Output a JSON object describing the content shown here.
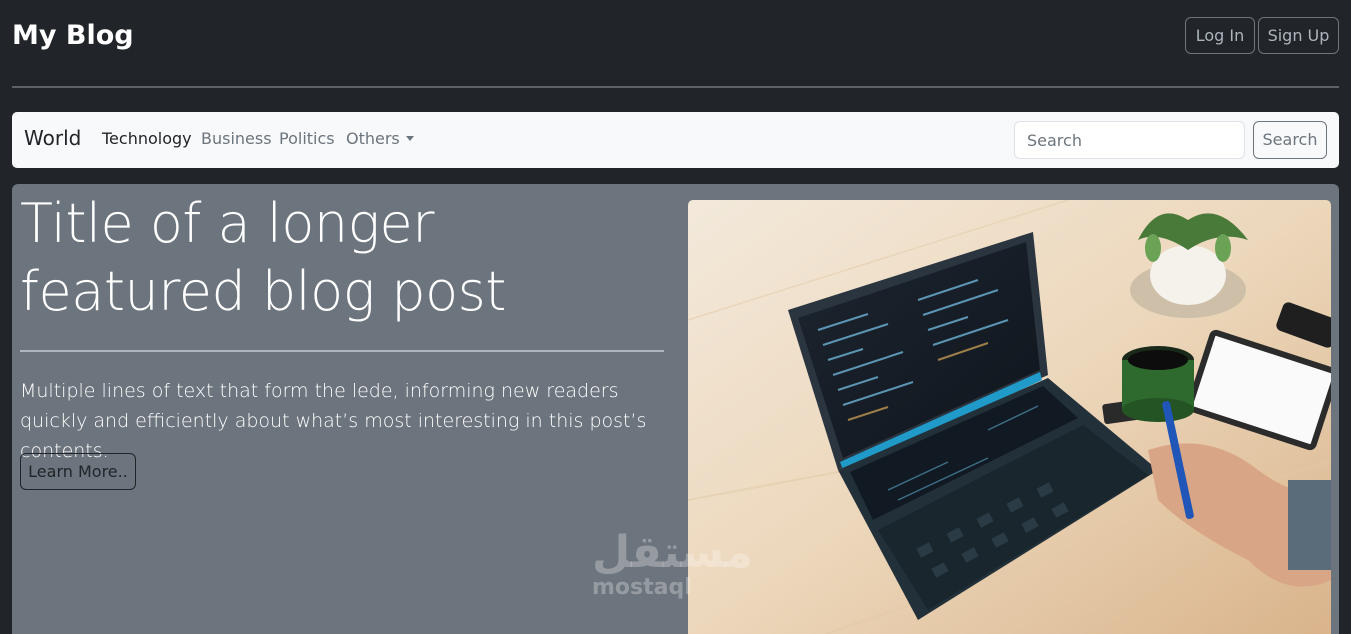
{
  "header": {
    "brand": "My Blog",
    "login_label": "Log In",
    "signup_label": "Sign Up"
  },
  "navbar": {
    "brand": "World",
    "links": [
      {
        "label": "Technology",
        "active": true
      },
      {
        "label": "Business",
        "active": false
      },
      {
        "label": "Politics",
        "active": false
      },
      {
        "label": "Others",
        "active": false,
        "dropdown": true
      }
    ],
    "search_placeholder": "Search",
    "search_button": "Search"
  },
  "hero": {
    "title": "Title of a longer featured blog post",
    "lede": "Multiple lines of text that form the lede, informing new readers quickly and efficiently about what’s most interesting in this post’s contents.",
    "cta_label": "Learn More..",
    "image_subject": "laptop-with-code-on-desk"
  },
  "watermark": {
    "arabic": "مستقل",
    "latin": "mostaql"
  },
  "colors": {
    "page_bg": "#212529",
    "navbar_bg": "#f8f9fa",
    "hero_bg": "#6c757d"
  }
}
